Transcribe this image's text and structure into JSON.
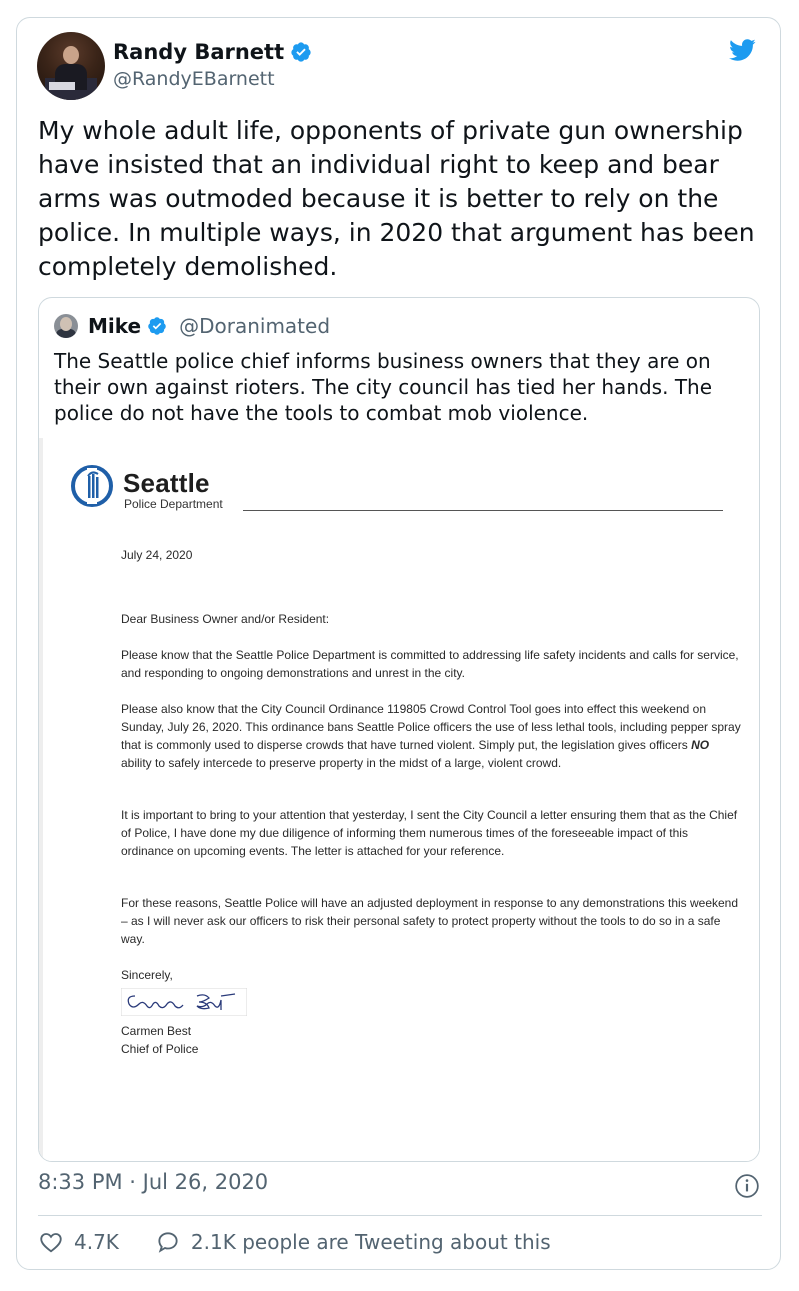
{
  "author": {
    "name": "Randy Barnett",
    "handle": "@RandyEBarnett"
  },
  "tweet_text": "My whole adult life, opponents of private gun ownership have insisted that an individual right to keep and bear arms was outmoded because it is better to rely on the police. In multiple ways, in 2020 that argument has been completely demolished.",
  "quoted": {
    "name": "Mike",
    "handle": "@Doranimated",
    "text": "The Seattle police chief informs business owners that they are on their own against rioters. The city council has tied her hands. The police do not have the tools to combat mob violence."
  },
  "letter": {
    "org": "Seattle",
    "dept": "Police Department",
    "date": "July 24, 2020",
    "salutation": "Dear Business Owner and/or Resident:",
    "p1": "Please know that the Seattle Police Department is committed to addressing life safety incidents and calls for service, and responding to ongoing demonstrations and unrest in the city.",
    "p2_before": "Please also know that the City Council Ordinance 119805 Crowd Control Tool goes into effect this weekend on Sunday, July 26, 2020. This ordinance bans Seattle Police officers the use of less lethal tools, including pepper spray that is commonly used to disperse crowds that have turned violent. Simply put, the legislation gives officers ",
    "p2_emph": "NO",
    "p2_after": " ability to safely intercede to preserve property in the midst of a large, violent crowd.",
    "p3": "It is important to bring to your attention that yesterday, I sent the City Council a letter ensuring them that as the Chief of Police, I have done my due diligence of informing them numerous times of the foreseeable impact of this ordinance on upcoming events. The letter is attached for your reference.",
    "p4": "For these reasons, Seattle Police will have an adjusted deployment in response to any demonstrations this weekend – as I will never ask our officers to risk their personal safety to protect property without the tools to do so in a safe way.",
    "closing": "Sincerely,",
    "signature_text": "Carmen Best",
    "signer_name": "Carmen Best",
    "signer_title": "Chief of Police"
  },
  "timestamp": "8:33 PM · Jul 26, 2020",
  "likes": "4.7K",
  "tweeting": "2.1K people are Tweeting about this",
  "colors": {
    "verified": "#1d9bf0",
    "twitter_blue": "#1d9bf0",
    "muted_text": "#536471",
    "border": "#cfd9de",
    "seattle_blue": "#1f5fa8"
  }
}
